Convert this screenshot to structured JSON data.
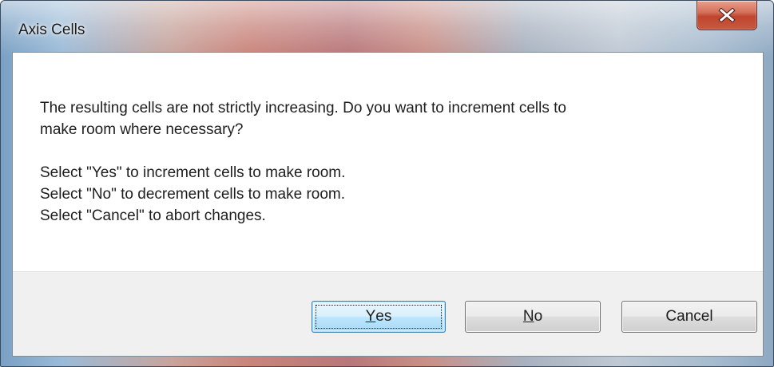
{
  "dialog": {
    "title": "Axis Cells",
    "message_lines": [
      "The resulting cells are not strictly increasing.  Do you want to increment cells to",
      "make room where necessary?"
    ],
    "instructions": [
      "Select \"Yes\" to increment cells to make room.",
      "Select \"No\" to decrement cells to make room.",
      "Select \"Cancel\" to abort changes."
    ]
  },
  "buttons": {
    "yes": {
      "mnemonic": "Y",
      "rest": "es"
    },
    "no": {
      "mnemonic": "N",
      "rest": "o"
    },
    "cancel": "Cancel"
  },
  "icons": {
    "close": "close-icon"
  },
  "colors": {
    "default_button_border": "#3c7fb1",
    "close_button": "#c0452e",
    "footer_bg": "#f0f0f0"
  }
}
